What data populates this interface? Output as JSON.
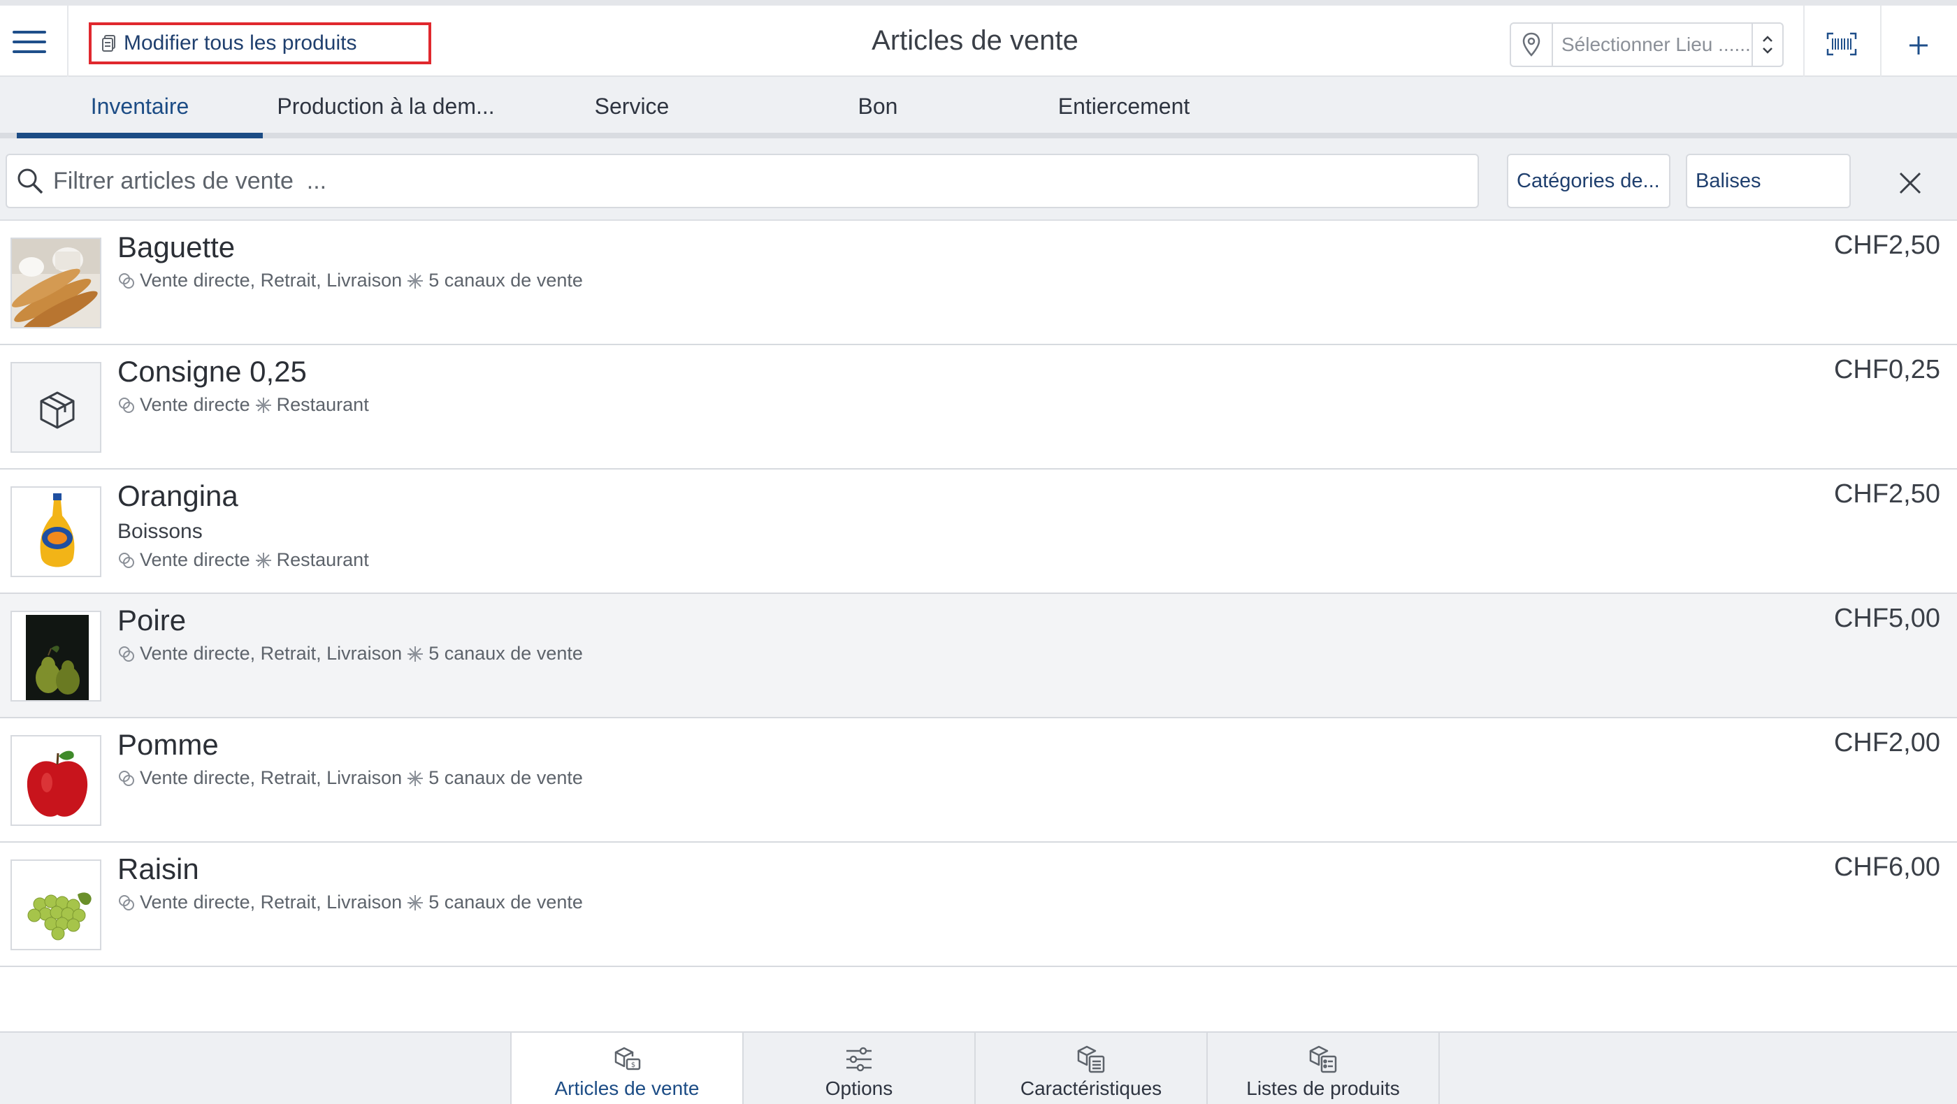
{
  "header": {
    "edit_all_label": "Modifier tous les produits",
    "title": "Articles de vente",
    "location_placeholder": "Sélectionner Lieu ......",
    "icons": [
      "menu-icon",
      "edit-icon",
      "location-pin-icon",
      "updown-chevron-icon",
      "barcode-scan-icon",
      "plus-icon"
    ]
  },
  "tabs": [
    {
      "label": "Inventaire",
      "active": true
    },
    {
      "label": "Production à la dem..."
    },
    {
      "label": "Service"
    },
    {
      "label": "Bon"
    },
    {
      "label": "Entiercement"
    }
  ],
  "filter": {
    "search_placeholder": "Filtrer articles de vente  ...",
    "categories_label": "Catégories de...",
    "tags_label": "Balises"
  },
  "items": [
    {
      "name": "Baguette",
      "category": "",
      "modes": "Vente directe, Retrait, Livraison",
      "channels": "5 canaux de vente",
      "price": "CHF2,50",
      "image": "baguette-photo"
    },
    {
      "name": "Consigne 0,25",
      "category": "",
      "modes": "Vente directe",
      "channels": "Restaurant",
      "price": "CHF0,25",
      "image": "box-placeholder-icon"
    },
    {
      "name": "Orangina",
      "category": "Boissons",
      "modes": "Vente directe",
      "channels": "Restaurant",
      "price": "CHF2,50",
      "image": "orangina-bottle-photo"
    },
    {
      "name": "Poire",
      "category": "",
      "modes": "Vente directe, Retrait, Livraison",
      "channels": "5 canaux de vente",
      "price": "CHF5,00",
      "image": "pear-photo",
      "highlighted": true
    },
    {
      "name": "Pomme",
      "category": "",
      "modes": "Vente directe, Retrait, Livraison",
      "channels": "5 canaux de vente",
      "price": "CHF2,00",
      "image": "apple-photo"
    },
    {
      "name": "Raisin",
      "category": "",
      "modes": "Vente directe, Retrait, Livraison",
      "channels": "5 canaux de vente",
      "price": "CHF6,00",
      "image": "grapes-photo"
    }
  ],
  "bottom_nav": [
    {
      "label": "Articles de vente",
      "active": true,
      "icon": "sale-items-icon"
    },
    {
      "label": "Options",
      "icon": "sliders-icon"
    },
    {
      "label": "Caractéristiques",
      "icon": "characteristics-icon"
    },
    {
      "label": "Listes de produits",
      "icon": "product-lists-icon"
    }
  ],
  "colors": {
    "accent": "#1c4c85",
    "highlight_border": "#e0282e",
    "bar_background": "#eef0f3"
  }
}
